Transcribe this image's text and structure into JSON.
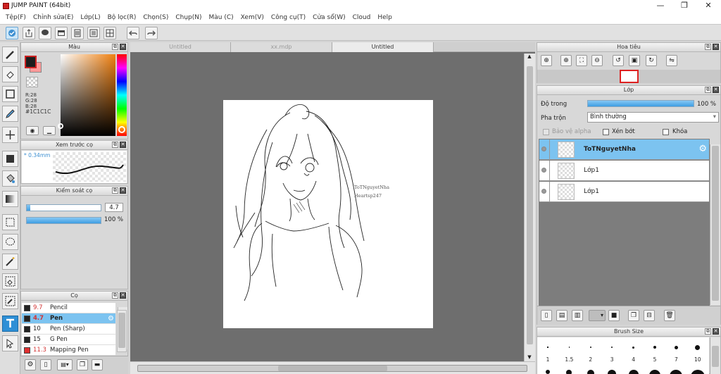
{
  "window": {
    "title": "JUMP PAINT (64bit)",
    "minimize": "—",
    "maximize": "❐",
    "close": "✕"
  },
  "menu": [
    "Tệp(F)",
    "Chỉnh sửa(E)",
    "Lớp(L)",
    "Bộ lọc(R)",
    "Chọn(S)",
    "Chụp(N)",
    "Màu (C)",
    "Xem(V)",
    "Công cụ(T)",
    "Cửa sổ(W)",
    "Cloud",
    "Help"
  ],
  "color_panel": {
    "title": "Màu",
    "r": "R:28",
    "g": "G:28",
    "b": "B:28",
    "hex": "#1C1C1C",
    "fg_color": "#1c1c1c",
    "bg_color": "#ff9a9a"
  },
  "brush_preview": {
    "title": "Xem trước cọ",
    "size": "* 0.34mm"
  },
  "brush_control": {
    "title": "Kiểm soát cọ",
    "size_value": "4.7",
    "opacity_value": "100 %",
    "size_level": 0.05,
    "opacity_level": 1.0
  },
  "brush_panel": {
    "title": "Cọ",
    "items": [
      {
        "size": "9.7",
        "name": "Pencil",
        "color": "#222222",
        "size_color": "#d23333"
      },
      {
        "size": "4.7",
        "name": "Pen",
        "color": "#222222",
        "size_color": "#d23333",
        "selected": true
      },
      {
        "size": "10",
        "name": "Pen (Sharp)",
        "color": "#222222",
        "size_color": "#222222"
      },
      {
        "size": "15",
        "name": "G Pen",
        "color": "#222222",
        "size_color": "#222222"
      },
      {
        "size": "11.3",
        "name": "Mapping Pen",
        "color": "#e03030",
        "size_color": "#d23333"
      }
    ]
  },
  "doc_tabs": [
    "Untitled",
    "xx.mdp",
    "Untitled"
  ],
  "canvas_text": {
    "line1": "ToTNguyetNha",
    "line2": "Heartsp247"
  },
  "navigator": {
    "title": "Hoa tiêu"
  },
  "layer_panel": {
    "title": "Lớp",
    "opacity_label": "Độ trong",
    "opacity_value": "100 %",
    "opacity_level": 1.0,
    "blend_label": "Pha trộn",
    "blend_value": "Bình thường",
    "protect_alpha": "Bảo vệ alpha",
    "clipping": "Xén bớt",
    "lock": "Khóa",
    "layers": [
      {
        "name": "ToTNguyetNha",
        "selected": true
      },
      {
        "name": "Lớp1",
        "selected": false
      },
      {
        "name": "Lớp1",
        "selected": false
      }
    ]
  },
  "brush_size": {
    "title": "Brush Size",
    "labels": [
      "1",
      "1.5",
      "2",
      "3",
      "4",
      "5",
      "7",
      "10"
    ]
  }
}
